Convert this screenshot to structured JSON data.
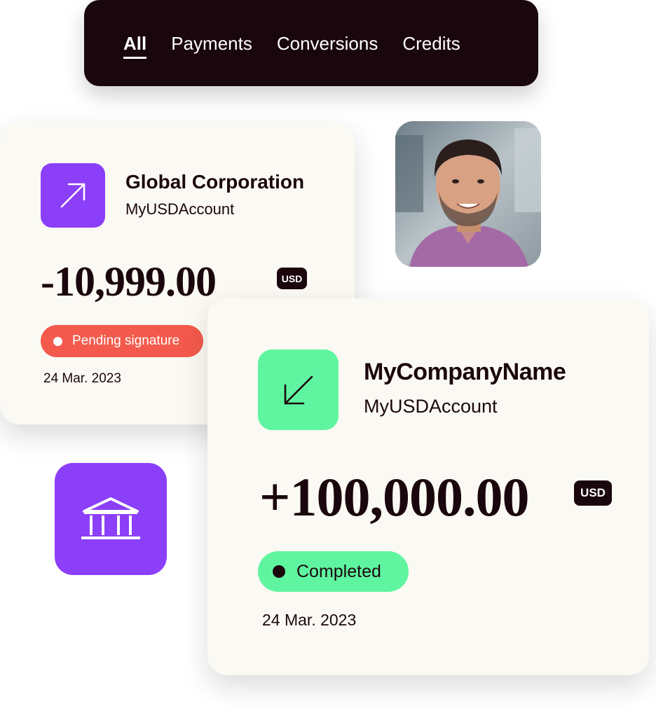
{
  "tabs": {
    "items": [
      {
        "label": "All",
        "active": true
      },
      {
        "label": "Payments",
        "active": false
      },
      {
        "label": "Conversions",
        "active": false
      },
      {
        "label": "Credits",
        "active": false
      }
    ]
  },
  "outgoing": {
    "icon": "arrow-up-right-icon",
    "name": "Global Corporation",
    "account": "MyUSDAccount",
    "amount": "-10,999.00",
    "currency": "USD",
    "status": "Pending signature",
    "status_color": "#f35a4d",
    "date": "24 Mar. 2023",
    "accent": "#8b3ff8"
  },
  "incoming": {
    "icon": "arrow-down-left-icon",
    "name": "MyCompanyName",
    "account": "MyUSDAccount",
    "amount": "+100,000.00",
    "currency": "USD",
    "status": "Completed",
    "status_color": "#5ff5a0",
    "date": "24 Mar. 2023",
    "accent": "#5ff5a0"
  },
  "avatar": {
    "icon": "user-photo"
  },
  "bank_tile": {
    "icon": "bank-icon",
    "color": "#8b3ff8"
  },
  "colors": {
    "dark": "#1a070d",
    "card_bg": "#fbf9f3"
  }
}
